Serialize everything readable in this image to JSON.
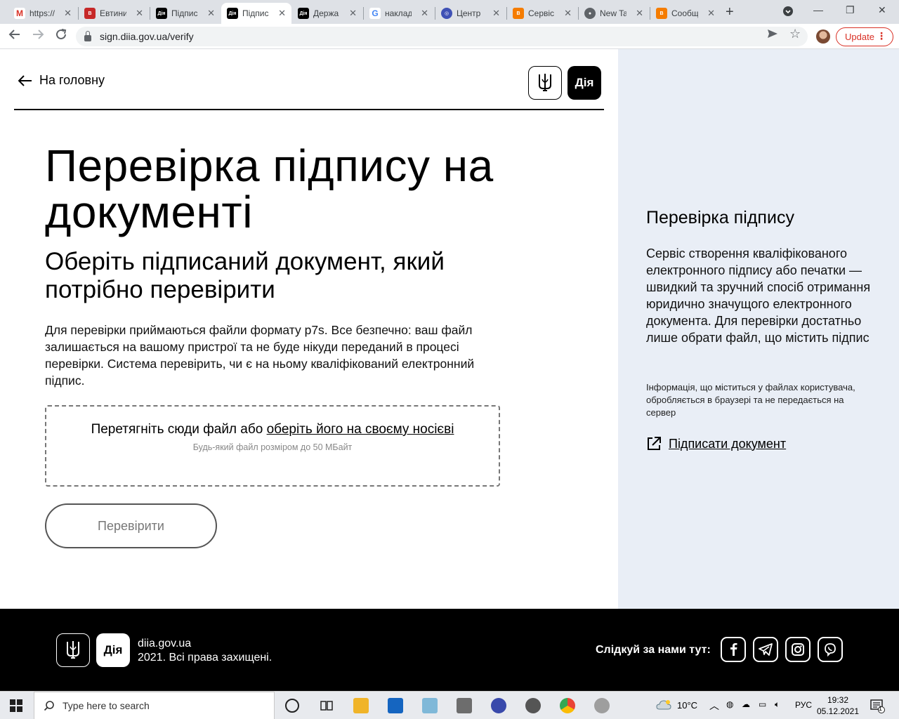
{
  "browser": {
    "tabs": [
      {
        "label": "https://",
        "favicon": "gmail-icon",
        "active": false
      },
      {
        "label": "Евтини",
        "favicon": "bentley-icon",
        "active": false
      },
      {
        "label": "Підпис",
        "favicon": "diia-icon",
        "active": false
      },
      {
        "label": "Підпис",
        "favicon": "diia-icon",
        "active": true
      },
      {
        "label": "Держа",
        "favicon": "diia-icon",
        "active": false
      },
      {
        "label": "наклад",
        "favicon": "google-icon",
        "active": false
      },
      {
        "label": "Центр",
        "favicon": "globe-icon",
        "active": false
      },
      {
        "label": "Сервіс",
        "favicon": "blogger-icon",
        "active": false
      },
      {
        "label": "New Ta",
        "favicon": "chrome-icon",
        "active": false
      },
      {
        "label": "Сообщ",
        "favicon": "blogger-icon",
        "active": false
      }
    ],
    "url": "sign.diia.gov.ua/verify",
    "update_label": "Update"
  },
  "page": {
    "back_label": "На головну",
    "logo_label": "Дія",
    "title": "Перевірка підпису на документі",
    "subtitle": "Оберіть підписаний документ, який потрібно перевірити",
    "description": "Для перевірки приймаються файли формату p7s. Все безпечно: ваш файл залишається на вашому пристрої та не буде нікуди переданий в процесі перевірки. Система перевірить, чи є на ньому кваліфікований електронний підпис.",
    "dropzone": {
      "text": "Перетягніть сюди файл або",
      "link": "оберіть його на своєму носієві",
      "hint": "Будь-який файл розміром до 50 МБайт"
    },
    "check_button": "Перевірити"
  },
  "aside": {
    "title": "Перевірка підпису",
    "text": "Сервіс створення кваліфікованого електронного підпису або печатки — швидкий та зручний спосіб отримання юридично значущого електронного документа. Для перевірки достатньо лише обрати файл, що містить підпис",
    "note": "Інформація, що міститься у файлах користувача, обробляється в браузері та не передається на сервер",
    "sign_link": "Підписати документ"
  },
  "footer": {
    "site": "diia.gov.ua",
    "copyright": "2021. Всі права захищені.",
    "follow": "Слідкуй за нами тут:",
    "logo_label": "Дія"
  },
  "taskbar": {
    "search_placeholder": "Type here to search",
    "temperature": "10°C",
    "language": "РУС",
    "time": "19:32",
    "date": "05.12.2021",
    "notification_count": "1"
  }
}
